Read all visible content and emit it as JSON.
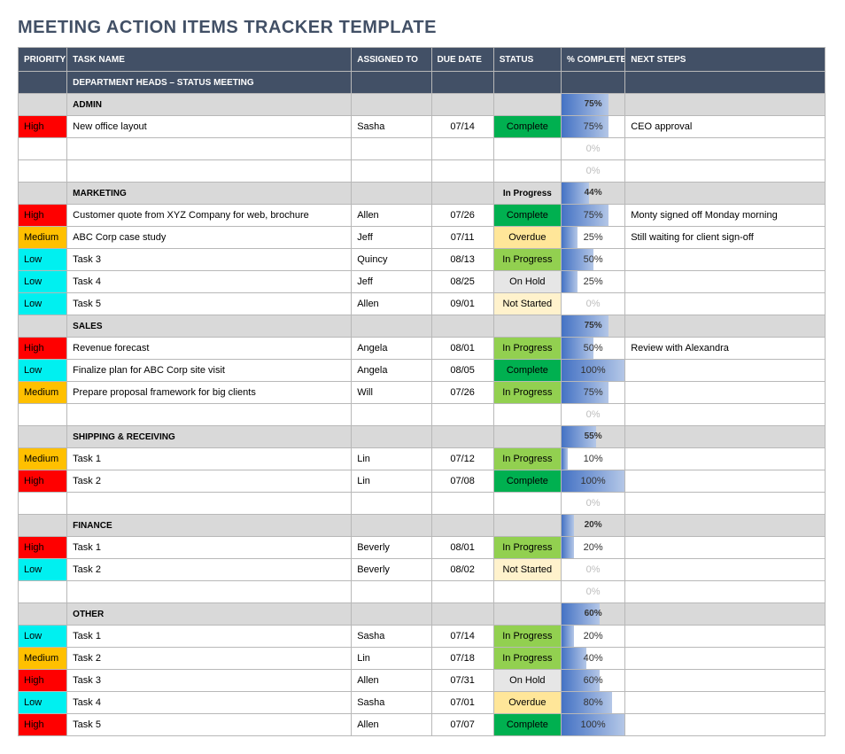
{
  "title": "MEETING ACTION ITEMS TRACKER TEMPLATE",
  "headers": {
    "priority": "PRIORITY",
    "task": "TASK NAME",
    "assigned": "ASSIGNED TO",
    "due": "DUE DATE",
    "status": "STATUS",
    "pct": "% COMPLETE",
    "next": "NEXT STEPS"
  },
  "section_label": "DEPARTMENT HEADS – STATUS MEETING",
  "groups": [
    {
      "name": "ADMIN",
      "pct": "75%",
      "rows": [
        {
          "priority": "High",
          "task": "New office layout",
          "assigned": "Sasha",
          "due": "07/14",
          "status": "Complete",
          "pct": "75%",
          "next": "CEO approval"
        },
        {
          "priority": "",
          "task": "",
          "assigned": "",
          "due": "",
          "status": "",
          "pct": "0%",
          "next": ""
        },
        {
          "priority": "",
          "task": "",
          "assigned": "",
          "due": "",
          "status": "",
          "pct": "0%",
          "next": ""
        }
      ]
    },
    {
      "name": "MARKETING",
      "status": "In Progress",
      "pct": "44%",
      "rows": [
        {
          "priority": "High",
          "task": "Customer quote from XYZ Company for web, brochure",
          "assigned": "Allen",
          "due": "07/26",
          "status": "Complete",
          "pct": "75%",
          "next": "Monty signed off Monday morning"
        },
        {
          "priority": "Medium",
          "task": "ABC Corp case study",
          "assigned": "Jeff",
          "due": "07/11",
          "status": "Overdue",
          "pct": "25%",
          "next": "Still waiting for client sign-off"
        },
        {
          "priority": "Low",
          "task": "Task 3",
          "assigned": "Quincy",
          "due": "08/13",
          "status": "In Progress",
          "pct": "50%",
          "next": ""
        },
        {
          "priority": "Low",
          "task": "Task 4",
          "assigned": "Jeff",
          "due": "08/25",
          "status": "On Hold",
          "pct": "25%",
          "next": ""
        },
        {
          "priority": "Low",
          "task": "Task 5",
          "assigned": "Allen",
          "due": "09/01",
          "status": "Not Started",
          "pct": "0%",
          "next": ""
        }
      ]
    },
    {
      "name": "SALES",
      "pct": "75%",
      "rows": [
        {
          "priority": "High",
          "task": "Revenue forecast",
          "assigned": "Angela",
          "due": "08/01",
          "status": "In Progress",
          "pct": "50%",
          "next": "Review with Alexandra"
        },
        {
          "priority": "Low",
          "task": "Finalize plan for ABC Corp site visit",
          "assigned": "Angela",
          "due": "08/05",
          "status": "Complete",
          "pct": "100%",
          "next": ""
        },
        {
          "priority": "Medium",
          "task": "Prepare proposal framework for big clients",
          "assigned": "Will",
          "due": "07/26",
          "status": "In Progress",
          "pct": "75%",
          "next": ""
        },
        {
          "priority": "",
          "task": "",
          "assigned": "",
          "due": "",
          "status": "",
          "pct": "0%",
          "next": ""
        }
      ]
    },
    {
      "name": "SHIPPING & RECEIVING",
      "pct": "55%",
      "rows": [
        {
          "priority": "Medium",
          "task": "Task 1",
          "assigned": "Lin",
          "due": "07/12",
          "status": "In Progress",
          "pct": "10%",
          "next": ""
        },
        {
          "priority": "High",
          "task": "Task 2",
          "assigned": "Lin",
          "due": "07/08",
          "status": "Complete",
          "pct": "100%",
          "next": ""
        },
        {
          "priority": "",
          "task": "",
          "assigned": "",
          "due": "",
          "status": "",
          "pct": "0%",
          "next": ""
        }
      ]
    },
    {
      "name": "FINANCE",
      "pct": "20%",
      "rows": [
        {
          "priority": "High",
          "task": "Task 1",
          "assigned": "Beverly",
          "due": "08/01",
          "status": "In Progress",
          "pct": "20%",
          "next": ""
        },
        {
          "priority": "Low",
          "task": "Task 2",
          "assigned": "Beverly",
          "due": "08/02",
          "status": "Not Started",
          "pct": "0%",
          "next": ""
        },
        {
          "priority": "",
          "task": "",
          "assigned": "",
          "due": "",
          "status": "",
          "pct": "0%",
          "next": ""
        }
      ]
    },
    {
      "name": "OTHER",
      "pct": "60%",
      "rows": [
        {
          "priority": "Low",
          "task": "Task 1",
          "assigned": "Sasha",
          "due": "07/14",
          "status": "In Progress",
          "pct": "20%",
          "next": ""
        },
        {
          "priority": "Medium",
          "task": "Task 2",
          "assigned": "Lin",
          "due": "07/18",
          "status": "In Progress",
          "pct": "40%",
          "next": ""
        },
        {
          "priority": "High",
          "task": "Task 3",
          "assigned": "Allen",
          "due": "07/31",
          "status": "On Hold",
          "pct": "60%",
          "next": ""
        },
        {
          "priority": "Low",
          "task": "Task 4",
          "assigned": "Sasha",
          "due": "07/01",
          "status": "Overdue",
          "pct": "80%",
          "next": ""
        },
        {
          "priority": "High",
          "task": "Task 5",
          "assigned": "Allen",
          "due": "07/07",
          "status": "Complete",
          "pct": "100%",
          "next": ""
        }
      ]
    }
  ]
}
